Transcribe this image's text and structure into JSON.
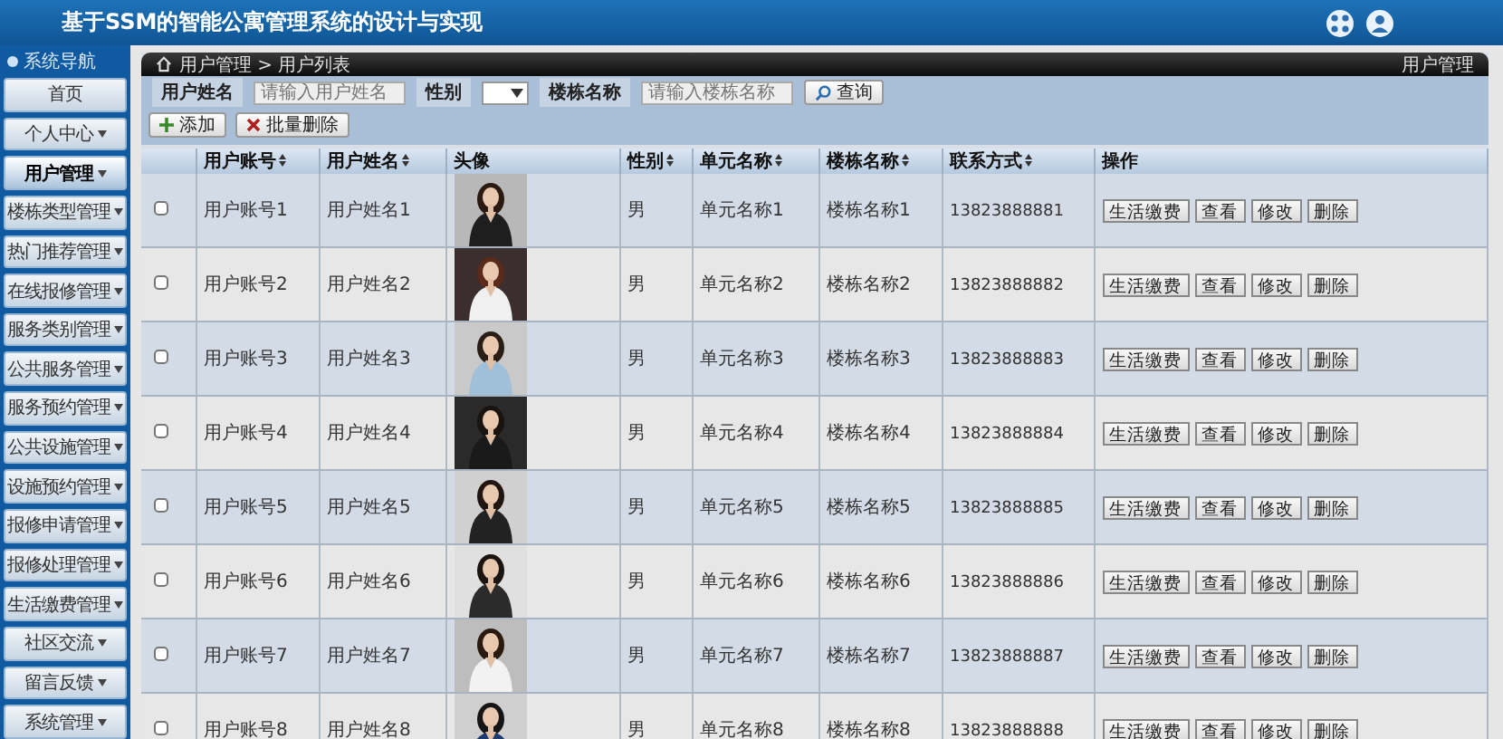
{
  "header": {
    "title": "基于SSM的智能公寓管理系统的设计与实现"
  },
  "sidebar": {
    "title": "系统导航",
    "items": [
      {
        "label": "首页",
        "has_menu": false,
        "selected": false
      },
      {
        "label": "个人中心",
        "has_menu": true,
        "selected": false
      },
      {
        "label": "用户管理",
        "has_menu": true,
        "selected": true
      },
      {
        "label": "楼栋类型管理",
        "has_menu": true,
        "selected": false
      },
      {
        "label": "热门推荐管理",
        "has_menu": true,
        "selected": false
      },
      {
        "label": "在线报修管理",
        "has_menu": true,
        "selected": false
      },
      {
        "label": "服务类别管理",
        "has_menu": true,
        "selected": false
      },
      {
        "label": "公共服务管理",
        "has_menu": true,
        "selected": false
      },
      {
        "label": "服务预约管理",
        "has_menu": true,
        "selected": false
      },
      {
        "label": "公共设施管理",
        "has_menu": true,
        "selected": false
      },
      {
        "label": "设施预约管理",
        "has_menu": true,
        "selected": false
      },
      {
        "label": "报修申请管理",
        "has_menu": true,
        "selected": false
      },
      {
        "label": "报修处理管理",
        "has_menu": true,
        "selected": false
      },
      {
        "label": "生活缴费管理",
        "has_menu": true,
        "selected": false
      },
      {
        "label": "社区交流",
        "has_menu": true,
        "selected": false
      },
      {
        "label": "留言反馈",
        "has_menu": true,
        "selected": false
      },
      {
        "label": "系统管理",
        "has_menu": true,
        "selected": false
      }
    ]
  },
  "breadcrumb": "用户管理 > 用户列表",
  "panel_title": "用户管理",
  "search": {
    "name_label": "用户姓名",
    "name_placeholder": "请输入用户姓名",
    "gender_label": "性别",
    "building_label": "楼栋名称",
    "building_placeholder": "请输入楼栋名称",
    "button": "查询"
  },
  "actions": [
    "添加",
    "批量删除"
  ],
  "table": {
    "columns": [
      {
        "label": "用户账号",
        "sortable": true
      },
      {
        "label": "用户姓名",
        "sortable": true
      },
      {
        "label": "头像",
        "sortable": false
      },
      {
        "label": "性别",
        "sortable": true
      },
      {
        "label": "单元名称",
        "sortable": true
      },
      {
        "label": "楼栋名称",
        "sortable": true
      },
      {
        "label": "联系方式",
        "sortable": true
      },
      {
        "label": "操作",
        "sortable": false
      }
    ],
    "rows": [
      {
        "checked": false,
        "account": "用户账号1",
        "name": "用户姓名1",
        "gender": "男",
        "unit": "单元名称1",
        "building": "楼栋名称1",
        "phone": "13823888881",
        "buttons": [
          "生活缴费",
          "查看",
          "修改",
          "删除"
        ]
      },
      {
        "checked": false,
        "account": "用户账号2",
        "name": "用户姓名2",
        "gender": "男",
        "unit": "单元名称2",
        "building": "楼栋名称2",
        "phone": "13823888882",
        "buttons": [
          "生活缴费",
          "查看",
          "修改",
          "删除"
        ]
      },
      {
        "checked": false,
        "account": "用户账号3",
        "name": "用户姓名3",
        "gender": "男",
        "unit": "单元名称3",
        "building": "楼栋名称3",
        "phone": "13823888883",
        "buttons": [
          "生活缴费",
          "查看",
          "修改",
          "删除"
        ]
      },
      {
        "checked": false,
        "account": "用户账号4",
        "name": "用户姓名4",
        "gender": "男",
        "unit": "单元名称4",
        "building": "楼栋名称4",
        "phone": "13823888884",
        "buttons": [
          "生活缴费",
          "查看",
          "修改",
          "删除"
        ]
      },
      {
        "checked": false,
        "account": "用户账号5",
        "name": "用户姓名5",
        "gender": "男",
        "unit": "单元名称5",
        "building": "楼栋名称5",
        "phone": "13823888885",
        "buttons": [
          "生活缴费",
          "查看",
          "修改",
          "删除"
        ]
      },
      {
        "checked": false,
        "account": "用户账号6",
        "name": "用户姓名6",
        "gender": "男",
        "unit": "单元名称6",
        "building": "楼栋名称6",
        "phone": "13823888886",
        "buttons": [
          "生活缴费",
          "查看",
          "修改",
          "删除"
        ]
      },
      {
        "checked": false,
        "account": "用户账号7",
        "name": "用户姓名7",
        "gender": "男",
        "unit": "单元名称7",
        "building": "楼栋名称7",
        "phone": "13823888887",
        "buttons": [
          "生活缴费",
          "查看",
          "修改",
          "删除"
        ]
      },
      {
        "checked": false,
        "account": "用户账号8",
        "name": "用户姓名8",
        "gender": "男",
        "unit": "单元名称8",
        "building": "楼栋名称8",
        "phone": "13823888888",
        "buttons": [
          "生活缴费",
          "查看",
          "修改",
          "删除"
        ]
      }
    ]
  }
}
